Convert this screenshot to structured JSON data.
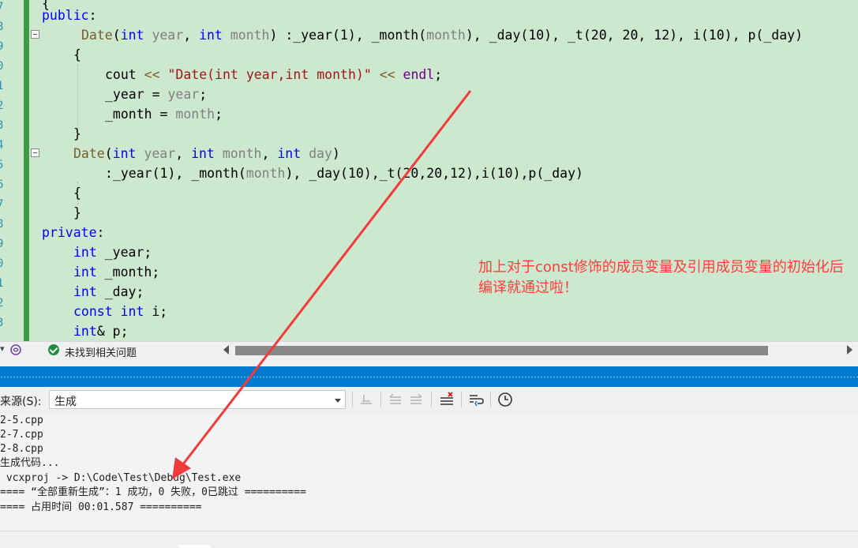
{
  "editor": {
    "line_numbers": [
      "7",
      "8",
      "9",
      "0",
      "1",
      "2",
      "3",
      "4",
      "5",
      "6",
      "7",
      "8",
      "9",
      "0",
      "1",
      "2",
      "3"
    ],
    "annotation": "加上对于const修饰的成员变量及引用成员变量的初始化后编译就通过啦！"
  },
  "editor_status": {
    "issues_text": "未找到相关问题"
  },
  "output_panel": {
    "source_label": "来源(S):",
    "source_value": "生成",
    "lines": [
      "2-5.cpp",
      "2-7.cpp",
      "2-8.cpp",
      "生成代码...",
      " vcxproj -> D:\\Code\\Test\\Debug\\Test.exe",
      "==== “全部重新生成”：1 成功，0 失败，0已跳过 ==========",
      "==== 占用时间 00:01.587 =========="
    ]
  },
  "colors": {
    "editor_background": "#cce8cf",
    "change_bar": "#3f9a46",
    "keyword": "#0000ff",
    "function": "#6f008a",
    "parameter": "#808080",
    "string": "#a31515",
    "annotation": "#ff3b3b",
    "panel_title": "#007acc"
  }
}
